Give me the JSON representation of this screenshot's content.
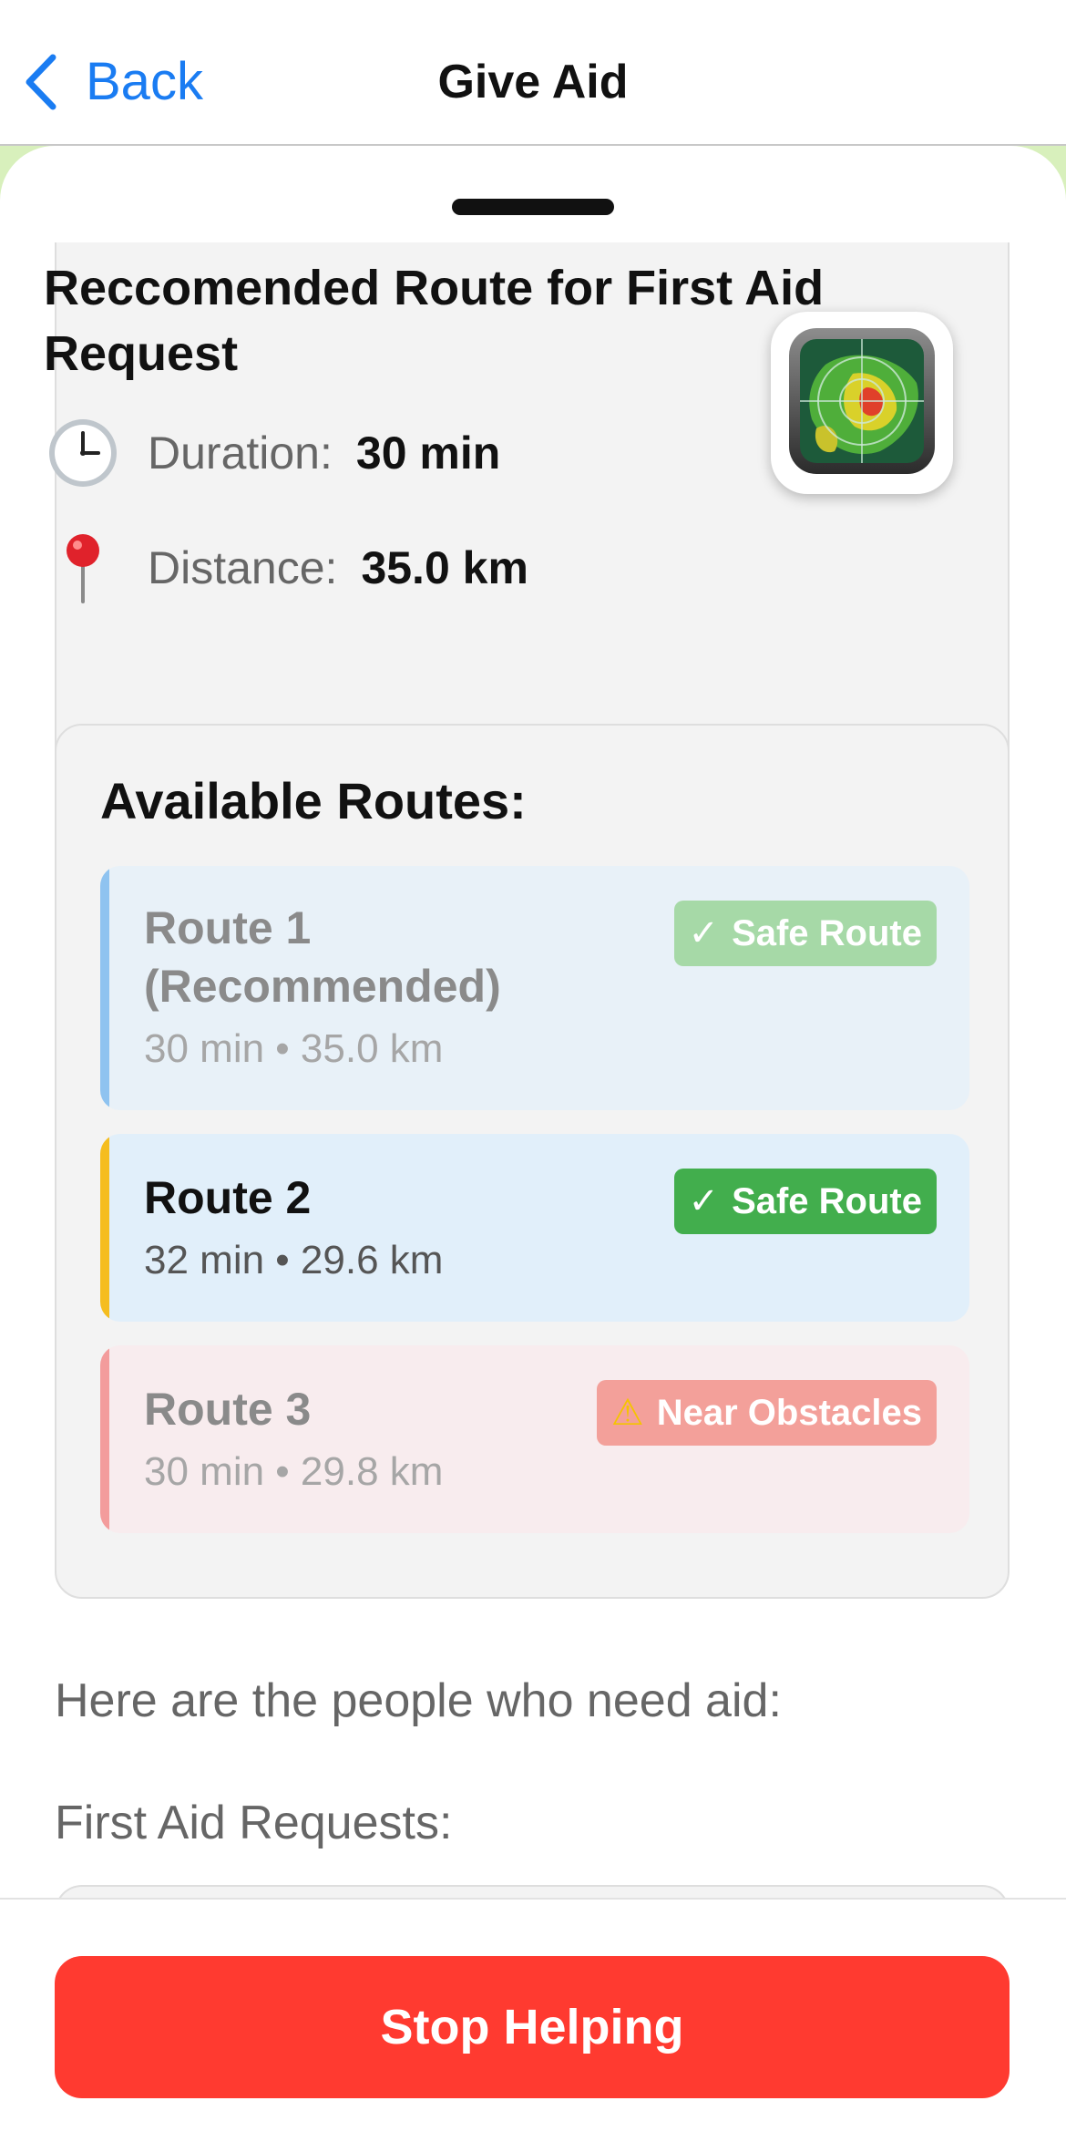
{
  "nav": {
    "back_label": "Back",
    "title": "Give Aid"
  },
  "summary": {
    "title": "Reccomended Route for First Aid Request",
    "duration_label": "Duration:",
    "duration_value": "30 min",
    "distance_label": "Distance:",
    "distance_value": "35.0 km"
  },
  "routes": {
    "title": "Available Routes:",
    "items": [
      {
        "name": "Route 1\n(Recommended)",
        "meta": "30 min • 35.0 km",
        "badge": "Safe Route",
        "badge_glyph": "✓",
        "status": "safe",
        "accent": "#8fc3f0",
        "badge_color": "#a6d9a7"
      },
      {
        "name": "Route 2",
        "meta": "32 min • 29.6 km",
        "badge": "Safe Route",
        "badge_glyph": "✓",
        "status": "safe",
        "accent": "#f5bd1f",
        "badge_color": "#42ae4d"
      },
      {
        "name": "Route 3",
        "meta": "30 min • 29.8 km",
        "badge": "Near Obstacles",
        "badge_glyph": "⚠",
        "status": "warning",
        "accent": "#f39c9c",
        "badge_color": "#f3a09a"
      }
    ]
  },
  "people_text": "Here are the people who need aid:",
  "requests_label": "First Aid Requests:",
  "stop_button_label": "Stop Helping",
  "colors": {
    "accent_blue": "#1a7cf2",
    "danger_red": "#ff3a30",
    "card_bg": "#f3f3f3"
  }
}
